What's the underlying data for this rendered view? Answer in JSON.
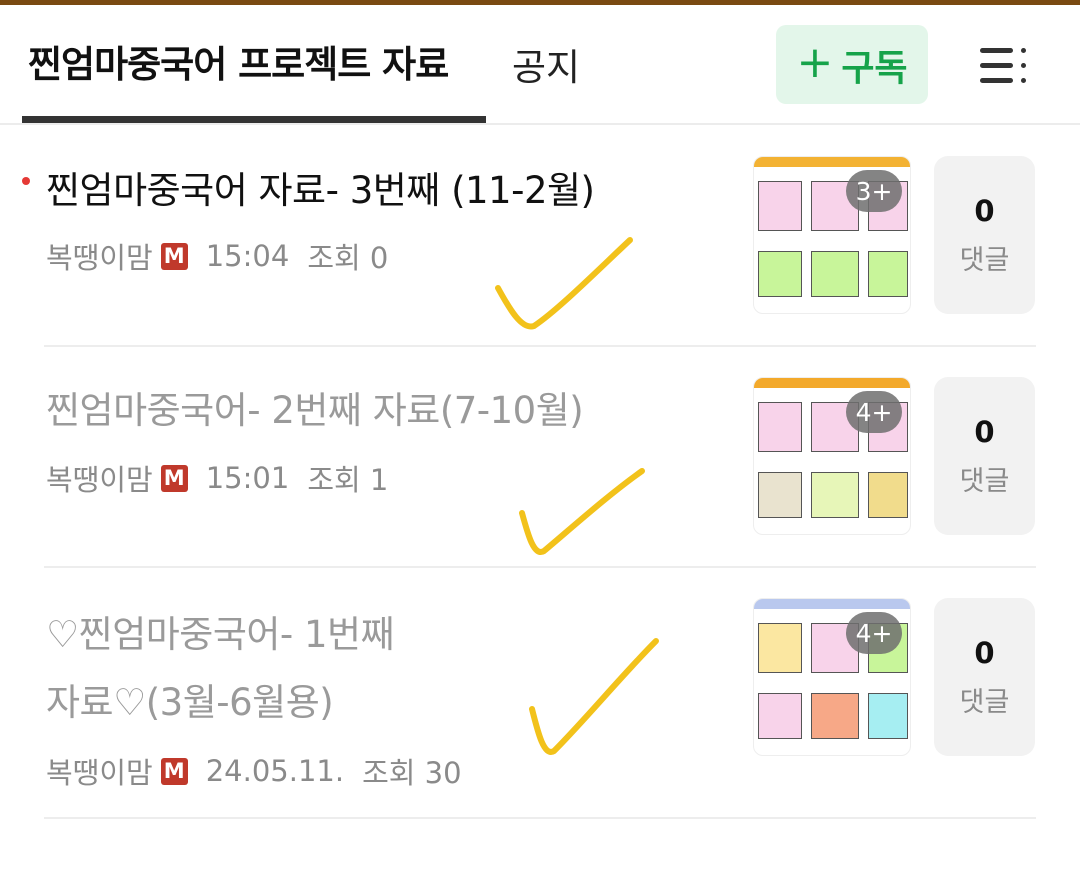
{
  "header": {
    "active_tab": "찐엄마중국어 프로젝트 자료",
    "notice_tab": "공지",
    "subscribe_plus": "+",
    "subscribe_label": "구독"
  },
  "posts": [
    {
      "title": "찐엄마중국어 자료- 3번째 (11-2월)",
      "author": "복땡이맘",
      "badge": "M",
      "time": "15:04",
      "views": "조회 0",
      "image_count": "3+",
      "comment_count": "0",
      "comment_label": "댓글",
      "read": false
    },
    {
      "title": "찐엄마중국어- 2번째 자료(7-10월)",
      "author": "복땡이맘",
      "badge": "M",
      "time": "15:01",
      "views": "조회 1",
      "image_count": "4+",
      "comment_count": "0",
      "comment_label": "댓글",
      "read": true
    },
    {
      "title_line1": "♡찐엄마중국어- 1번째",
      "title_line2": "자료♡(3월-6월용)",
      "author": "복땡이맘",
      "badge": "M",
      "time": "24.05.11.",
      "views": "조회 30",
      "image_count": "4+",
      "comment_count": "0",
      "comment_label": "댓글",
      "read": true
    }
  ],
  "colors": {
    "accent_green": "#16a34a",
    "subscribe_bg": "#e3f6ea",
    "unread_dot": "#e53935",
    "badge_red": "#c0392b",
    "check_mark": "#f2c21b"
  }
}
